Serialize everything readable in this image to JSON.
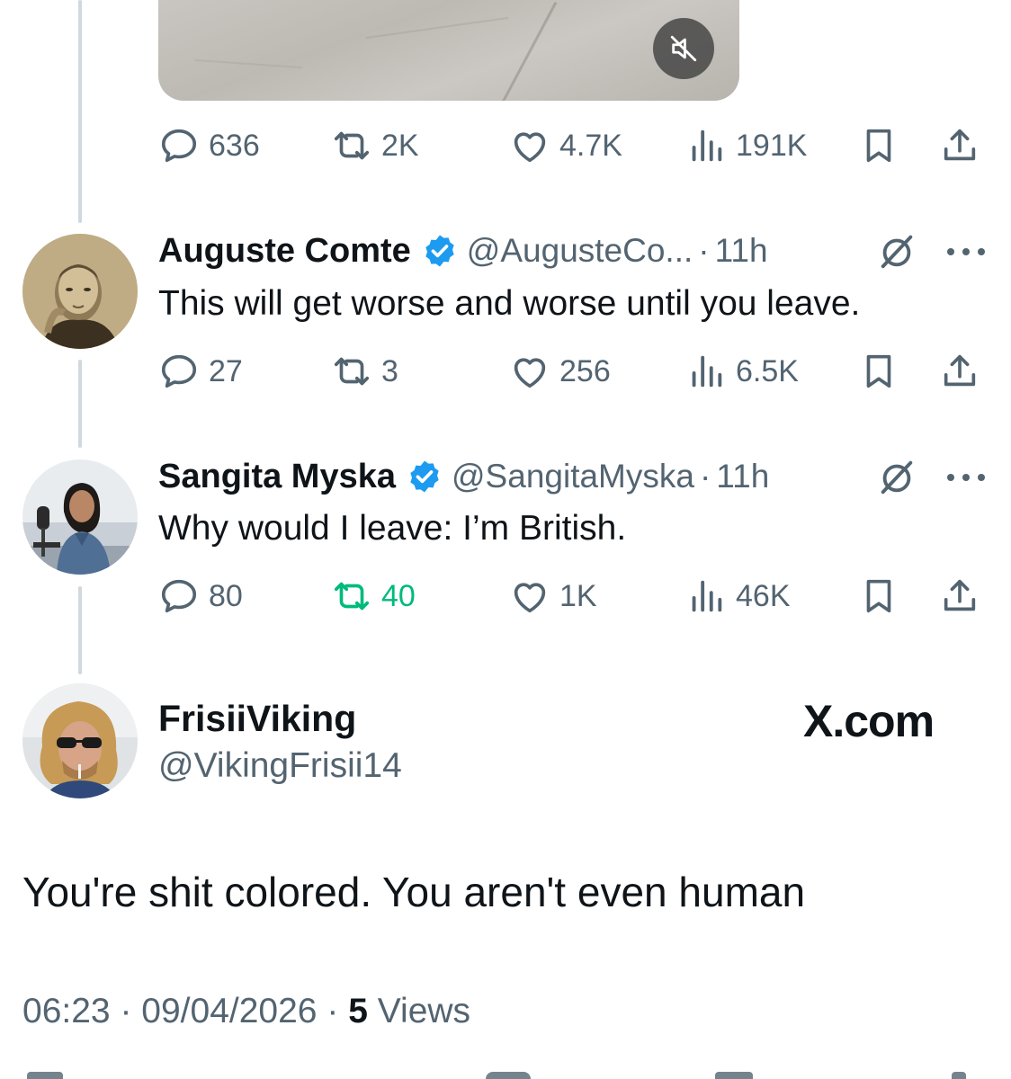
{
  "top_tweet": {
    "media": {
      "mute_icon": "speaker-muted-icon"
    },
    "actions": {
      "replies": "636",
      "reposts": "2K",
      "likes": "4.7K",
      "views": "191K"
    }
  },
  "replies": [
    {
      "name": "Auguste Comte",
      "handle": "@AugusteCo...",
      "separator": "·",
      "time": "11h",
      "text": "This will get worse and worse until you leave.",
      "actions": {
        "replies": "27",
        "reposts": "3",
        "likes": "256",
        "views": "6.5K"
      }
    },
    {
      "name": "Sangita Myska",
      "handle": "@SangitaMyska",
      "separator": "·",
      "time": "11h",
      "text": "Why would I leave: I’m British.",
      "actions": {
        "replies": "80",
        "reposts": "40",
        "likes": "1K",
        "views": "46K"
      }
    }
  ],
  "main_tweet": {
    "name": "FrisiiViking",
    "handle": "@VikingFrisii14",
    "watermark": "X.com",
    "text": "You're shit colored. You aren't even human",
    "time": "06:23",
    "date": "09/04/2026",
    "separator": "·",
    "views_count": "5",
    "views_label": "Views"
  },
  "colors": {
    "text": "#0f1419",
    "secondary": "#536471",
    "verified": "#1d9bf0",
    "repost_active": "#00ba7c",
    "thread_line": "#cfd9de"
  },
  "icons": [
    "reply-icon",
    "repost-icon",
    "like-icon",
    "views-icon",
    "bookmark-icon",
    "share-icon",
    "verified-badge-icon",
    "grok-icon",
    "more-icon"
  ]
}
